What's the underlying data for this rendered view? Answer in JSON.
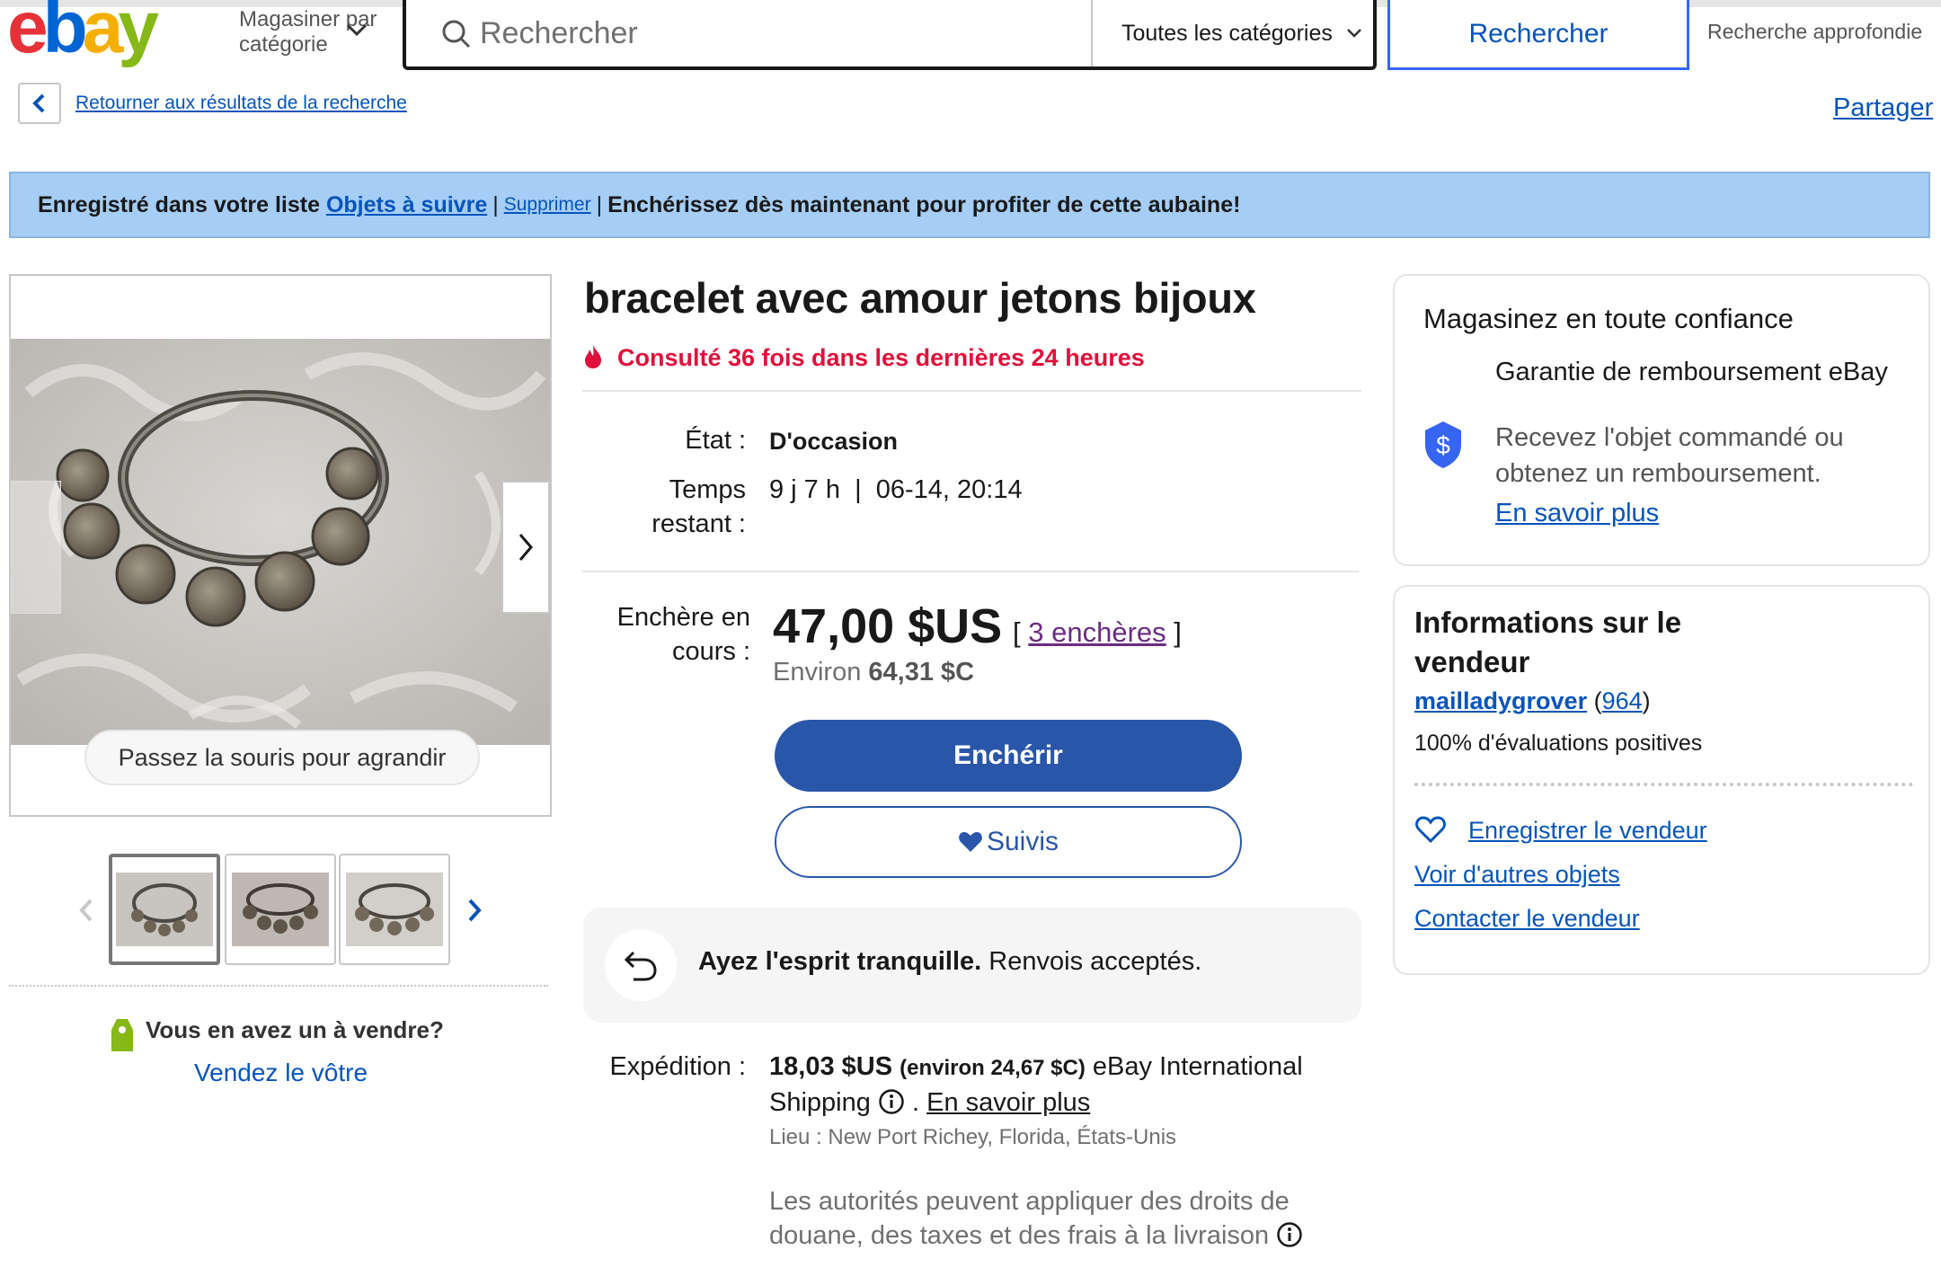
{
  "header": {
    "logo_text": "ebay",
    "shop_by_category": "Magasiner par catégorie",
    "search_placeholder": "Rechercher",
    "category_select": "Toutes les catégories",
    "search_button": "Rechercher",
    "advanced_search": "Recherche approfondie"
  },
  "nav": {
    "back_label": "Retourner aux résultats de la recherche",
    "share_label": "Partager"
  },
  "banner": {
    "prefix": "Enregistré dans votre liste",
    "watchlist_link": "Objets à suivre",
    "sep1": "|",
    "remove_link": "Supprimer",
    "sep2": "|",
    "message": "Enchérissez dès maintenant pour profiter de cette aubaine!"
  },
  "gallery": {
    "zoom_hint": "Passez la souris pour agrandir",
    "thumbnail_count": 3,
    "selected_index": 0
  },
  "sell": {
    "question": "Vous en avez un à vendre?",
    "link": "Vendez le vôtre"
  },
  "item": {
    "title": "bracelet avec amour jetons bijoux",
    "views": "Consulté 36 fois dans les dernières 24 heures",
    "condition_label": "État :",
    "condition_value": "D'occasion",
    "time_label": "Temps restant :",
    "time_value": "9 j 7 h  |  06-14, 20:14",
    "bid_label": "Enchère en cours :",
    "price": "47,00 $US",
    "bids_open": "[",
    "bids_link": "3 enchères",
    "bids_close": "]",
    "approx_prefix": "Environ",
    "approx_value": "64,31 $C",
    "bid_button": "Enchérir",
    "watch_button": "Suivis",
    "returns_bold": "Ayez l'esprit tranquille.",
    "returns_text": "Renvois acceptés.",
    "shipping_label": "Expédition :",
    "shipping_price": "18,03 $US",
    "shipping_approx": "(environ 24,67 $C)",
    "shipping_service": "eBay International Shipping",
    "shipping_more_link": "En savoir plus",
    "location": "Lieu : New Port Richey, Florida, États-Unis",
    "duties": "Les autorités peuvent appliquer des droits de douane, des taxes et des frais à la livraison"
  },
  "confidence": {
    "title": "Magasinez en toute confiance",
    "guarantee_title": "Garantie de remboursement eBay",
    "guarantee_desc": "Recevez l'objet commandé ou obtenez un remboursement.",
    "learn_more": "En savoir plus"
  },
  "seller": {
    "title": "Informations sur le vendeur",
    "name": "mailladygrover",
    "score": "964",
    "feedback": "100% d'évaluations positives",
    "save_seller": "Enregistrer le vendeur",
    "other_items": "Voir d'autres objets",
    "contact": "Contacter le vendeur"
  },
  "colors": {
    "primary_blue": "#2a56a9",
    "link_blue": "#0654ba",
    "banner_bg": "#a5cdf5",
    "alert_red": "#e0103a"
  }
}
